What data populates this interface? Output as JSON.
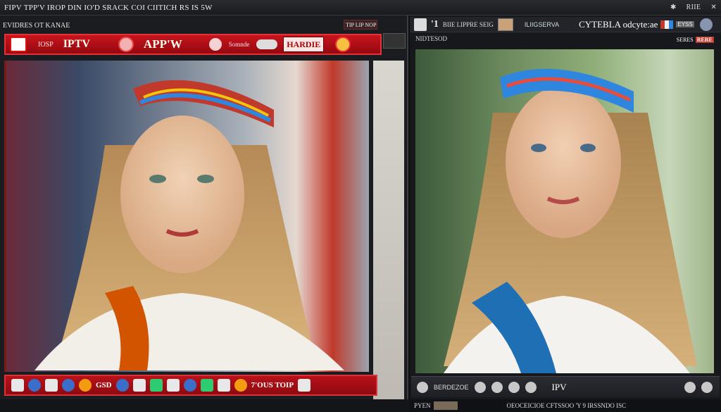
{
  "window": {
    "title": "FIPV TPP'V IROP DIN   IO'D SRACK COI   CIITICH RS IS 5W",
    "controls": [
      "✱",
      "RIIE",
      "✕"
    ]
  },
  "left_panel": {
    "header_label": "EVIDRES OT KANAE",
    "header_tab": "TIP LIP NOP",
    "redbar": {
      "t1": "IOSP",
      "brand": "IPTV",
      "app": "APP'W",
      "t2": "Somnde",
      "box": "HARDIE"
    },
    "dock_labels": [
      "GSD",
      "7'OUS TOIP"
    ]
  },
  "right_panel": {
    "header_num": "'1",
    "header_text": "BIIE LIPPRE SEIG",
    "header_chan": "ILIIGSERVA",
    "header_brand": "CYTEBLA odcyte:ae",
    "header_tag": "EYSS",
    "sub_left": "NIDTESOD",
    "sub_right": "SERES",
    "sub_badge": "RERE",
    "dock_text": "BERDEZOE",
    "dock_iptv": "IPV"
  },
  "footer": {
    "left": "PYEN",
    "text": "OEOCEICIOE CFTSSOO 'Y 9 IRSSNDO ISC"
  },
  "icons": [
    "hamburger-icon",
    "close-icon",
    "play-icon",
    "tv-icon",
    "gear-icon"
  ]
}
